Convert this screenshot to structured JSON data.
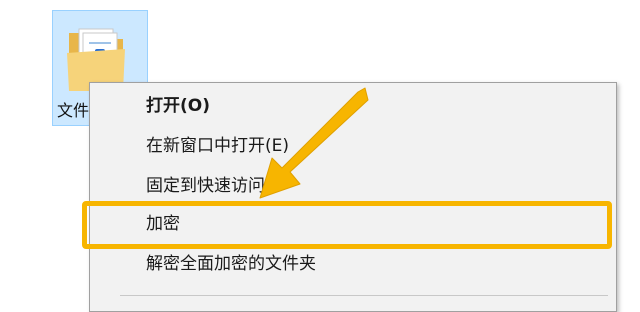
{
  "desktop": {
    "folder_label": "文件"
  },
  "context_menu": {
    "items": [
      {
        "label": "打开(O)"
      },
      {
        "label": "在新窗口中打开(E)"
      },
      {
        "label": "固定到快速访问"
      },
      {
        "label": "加密"
      },
      {
        "label": "解密全面加密的文件夹"
      }
    ]
  },
  "annotation": {
    "highlight_color": "#f7b500",
    "icon": "arrow-icon"
  }
}
